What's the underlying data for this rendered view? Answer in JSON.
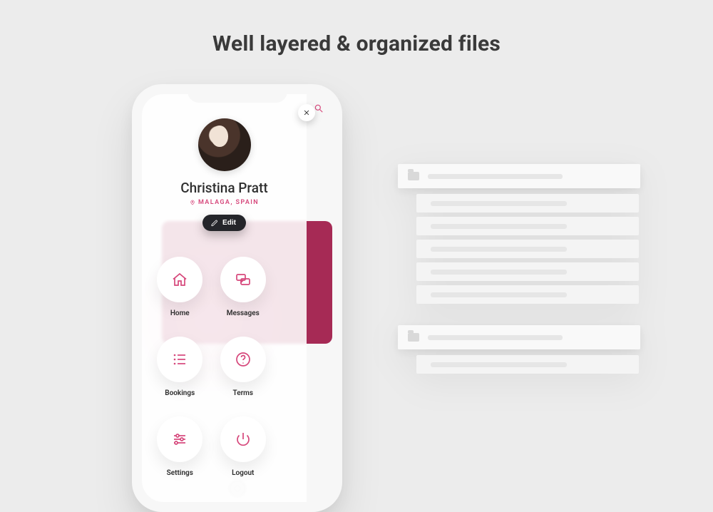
{
  "headline": "Well layered & organized files",
  "profile": {
    "name": "Christina Pratt",
    "location": "MALAGA, SPAIN",
    "edit_label": "Edit"
  },
  "menu": [
    {
      "id": "home",
      "label": "Home"
    },
    {
      "id": "messages",
      "label": "Messages"
    },
    {
      "id": "bookings",
      "label": "Bookings"
    },
    {
      "id": "terms",
      "label": "Terms"
    },
    {
      "id": "settings",
      "label": "Settings"
    },
    {
      "id": "logout",
      "label": "Logout"
    }
  ],
  "colors": {
    "accent": "#d6477b",
    "dark": "#24252a"
  }
}
